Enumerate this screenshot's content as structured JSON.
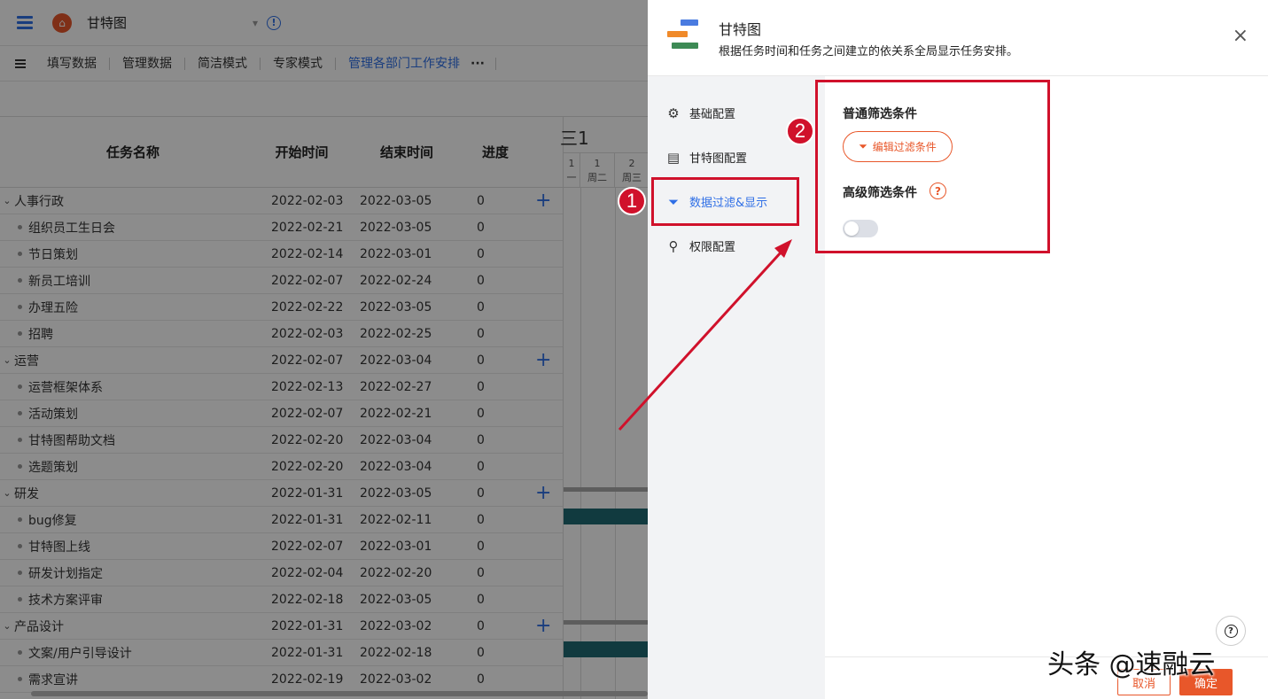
{
  "app": {
    "title": "甘特图",
    "toolbar": {
      "items": [
        "填写数据",
        "管理数据",
        "简洁模式",
        "专家模式",
        "管理各部门工作安排"
      ],
      "more": "···"
    }
  },
  "grid": {
    "headers": {
      "name": "任务名称",
      "start": "开始时间",
      "end": "结束时间",
      "progress": "进度"
    },
    "rows": [
      {
        "group": true,
        "name": "人事行政",
        "start": "2022-02-03",
        "end": "2022-03-05",
        "progress": "0"
      },
      {
        "group": false,
        "name": "组织员工生日会",
        "start": "2022-02-21",
        "end": "2022-03-05",
        "progress": "0"
      },
      {
        "group": false,
        "name": "节日策划",
        "start": "2022-02-14",
        "end": "2022-03-01",
        "progress": "0"
      },
      {
        "group": false,
        "name": "新员工培训",
        "start": "2022-02-07",
        "end": "2022-02-24",
        "progress": "0"
      },
      {
        "group": false,
        "name": "办理五险",
        "start": "2022-02-22",
        "end": "2022-03-05",
        "progress": "0"
      },
      {
        "group": false,
        "name": "招聘",
        "start": "2022-02-03",
        "end": "2022-02-25",
        "progress": "0"
      },
      {
        "group": true,
        "name": "运营",
        "start": "2022-02-07",
        "end": "2022-03-04",
        "progress": "0"
      },
      {
        "group": false,
        "name": "运营框架体系",
        "start": "2022-02-13",
        "end": "2022-02-27",
        "progress": "0"
      },
      {
        "group": false,
        "name": "活动策划",
        "start": "2022-02-07",
        "end": "2022-02-21",
        "progress": "0"
      },
      {
        "group": false,
        "name": "甘特图帮助文档",
        "start": "2022-02-20",
        "end": "2022-03-04",
        "progress": "0"
      },
      {
        "group": false,
        "name": "选题策划",
        "start": "2022-02-20",
        "end": "2022-03-04",
        "progress": "0"
      },
      {
        "group": true,
        "name": "研发",
        "start": "2022-01-31",
        "end": "2022-03-05",
        "progress": "0"
      },
      {
        "group": false,
        "name": "bug修复",
        "start": "2022-01-31",
        "end": "2022-02-11",
        "progress": "0"
      },
      {
        "group": false,
        "name": "甘特图上线",
        "start": "2022-02-07",
        "end": "2022-03-01",
        "progress": "0"
      },
      {
        "group": false,
        "name": "研发计划指定",
        "start": "2022-02-04",
        "end": "2022-02-20",
        "progress": "0"
      },
      {
        "group": false,
        "name": "技术方案评审",
        "start": "2022-02-18",
        "end": "2022-03-05",
        "progress": "0"
      },
      {
        "group": true,
        "name": "产品设计",
        "start": "2022-01-31",
        "end": "2022-03-02",
        "progress": "0"
      },
      {
        "group": false,
        "name": "文案/用户引导设计",
        "start": "2022-01-31",
        "end": "2022-02-18",
        "progress": "0"
      },
      {
        "group": false,
        "name": "需求宣讲",
        "start": "2022-02-19",
        "end": "2022-03-02",
        "progress": "0"
      }
    ]
  },
  "gantt": {
    "month": "三1",
    "days": [
      {
        "num": "1",
        "week": "一"
      },
      {
        "num": "1",
        "week": "周二"
      },
      {
        "num": "2",
        "week": "周三"
      }
    ]
  },
  "drawer": {
    "title": "甘特图",
    "description": "根据任务时间和任务之间建立的依关系全局显示任务安排。",
    "close": "×",
    "nav": [
      "基础配置",
      "甘特图配置",
      "数据过滤&显示",
      "权限配置"
    ],
    "active_nav": 2,
    "normal_filter_label": "普通筛选条件",
    "edit_filter_button": "编辑过滤条件",
    "advanced_filter_label": "高级筛选条件",
    "advanced_filter_enabled": false,
    "cancel": "取消",
    "ok": "确定"
  },
  "annotations": {
    "badge1": "1",
    "badge2": "2"
  },
  "watermark": "头条 @速融云",
  "colors": {
    "accent_blue": "#2f6fe6",
    "accent_orange": "#e8572a",
    "annotation_red": "#d0112b",
    "gantt_bar": "#1f6b74"
  }
}
